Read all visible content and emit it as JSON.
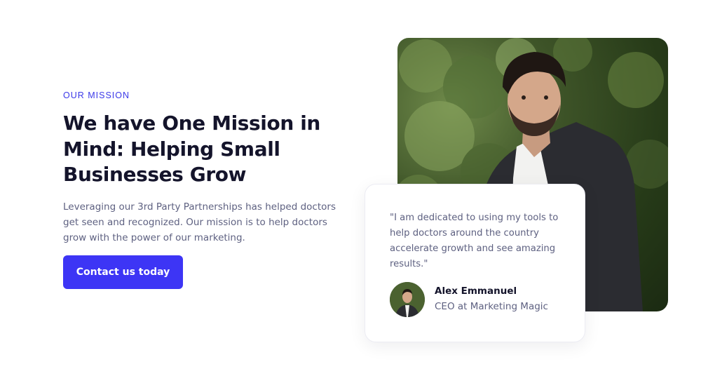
{
  "mission": {
    "eyebrow": "OUR MISSION",
    "headline": "We have One Mission in Mind: Helping Small Businesses Grow",
    "description": "Leveraging our 3rd Party Partnerships has helped doctors get seen and recognized. Our mission is to help doctors grow with the power of our marketing.",
    "cta_label": "Contact us today"
  },
  "testimonial": {
    "quote": "\"I am dedicated to using my tools to help doctors around the country accelerate growth and see amazing results.\"",
    "author_name": "Alex Emmanuel",
    "author_role": "CEO at Marketing Magic"
  },
  "colors": {
    "accent": "#3d35f5",
    "heading": "#14142b",
    "body": "#5e6181"
  }
}
